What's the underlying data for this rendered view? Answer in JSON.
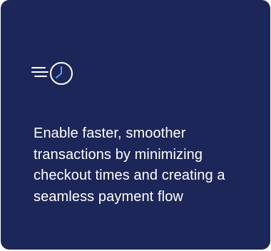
{
  "card": {
    "icon": "fast-clock-icon",
    "description": "Enable faster, smoother transactions by minimizing checkout times and creating a seamless payment flow",
    "colors": {
      "background": "#1d2658",
      "text": "#ffffff",
      "icon_stroke": "#ffffff",
      "icon_accent": "#4aa3ff"
    }
  }
}
